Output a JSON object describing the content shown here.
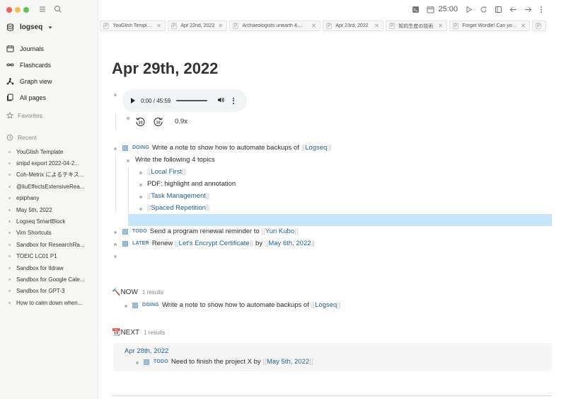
{
  "sidebar": {
    "graph_name": "logseq",
    "nav": [
      {
        "label": "Journals",
        "icon": "calendar-icon"
      },
      {
        "label": "Flashcards",
        "icon": "infinity-icon"
      },
      {
        "label": "Graph view",
        "icon": "graph-icon"
      },
      {
        "label": "All pages",
        "icon": "pages-icon"
      }
    ],
    "favorites_label": "Favorites",
    "recent_label": "Recent",
    "recent": [
      "YouGlish Template",
      "snipd export 2022-04-2...",
      "Coh-Metrix によるテキス...",
      "@liuEffectsExtensiveRea...",
      "epiphany",
      "May 5th, 2022",
      "Logseq SmartBlock",
      "Vim Shortcuts",
      "Sandbox for ResearchRa...",
      "TOEIC LC01 P1",
      "Sandbox for tldraw",
      "Sandbox for Google Cale...",
      "Sandbox for GPT-3",
      "How to calm down when..."
    ]
  },
  "toolbar": {
    "timer": "25:00"
  },
  "tabs": [
    {
      "prefix": "P",
      "title": "YouGlish Template"
    },
    {
      "prefix": "P",
      "title": "Apr 22nd, 2022"
    },
    {
      "prefix": "P",
      "title": "Archaeologists unearth 4,..."
    },
    {
      "prefix": "P",
      "title": "Apr 23rd, 2022"
    },
    {
      "prefix": "P",
      "title": "知的生産の技術"
    },
    {
      "prefix": "P",
      "title": "Forget Wordle! Can you c..."
    },
    {
      "prefix": "P",
      "title": ""
    }
  ],
  "page": {
    "title": "Apr 29th, 2022",
    "audio": {
      "time": "0:00 / 45:59"
    },
    "playback_speed": "0.9x",
    "blocks": {
      "b1": {
        "marker": "DOING",
        "text": "Write a note to show how to automate backups of ",
        "link": "Logseq"
      },
      "b1_child": "Write the following 4 topics",
      "topics": [
        {
          "link": "Local First"
        },
        {
          "text": "PDF: highlight and annotation"
        },
        {
          "link": "Task Management"
        },
        {
          "link": "Spaced Repetition"
        }
      ],
      "b2": {
        "marker": "TODO",
        "text": "Send a program renewal reminder to ",
        "link": "Yuri Kubo"
      },
      "b3": {
        "marker": "LATER",
        "text": "Renew ",
        "link": "Let's Encrypt Certificate",
        "text2": " by ",
        "link2": "May 6th, 2022"
      }
    },
    "queries": {
      "now": {
        "icon": "🔨",
        "title": "NOW",
        "count": "1 results",
        "item": {
          "marker": "DOING",
          "text": "Write a note to show how to automate backups of ",
          "link": "Logseq"
        }
      },
      "next": {
        "icon": "📆",
        "title": "NEXT",
        "count": "1 results",
        "group": "Apr 28th, 2022",
        "item": {
          "marker": "TODO",
          "text": "Need to finish the project X by ",
          "link": "May 5th, 2022"
        }
      }
    }
  },
  "colors": {
    "accent_link": "#1f5f8f",
    "marker": "#4a7fa5",
    "selection": "#c7e6fb",
    "checkbox": "#9cbfd6"
  }
}
